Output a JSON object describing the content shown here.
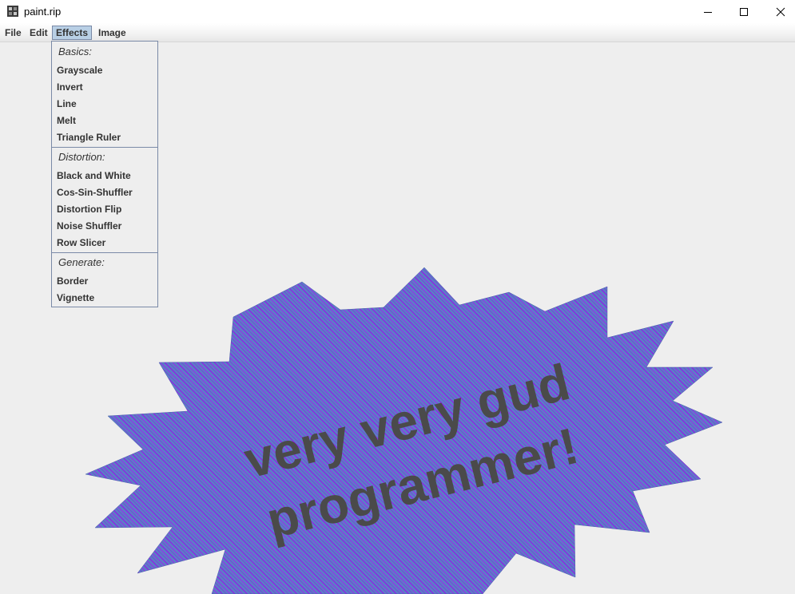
{
  "window": {
    "title": "paint.rip",
    "controls": [
      "minimize-icon",
      "maximize-icon",
      "close-icon"
    ]
  },
  "menubar": {
    "items": [
      {
        "label": "File"
      },
      {
        "label": "Edit"
      },
      {
        "label": "Effects",
        "active": true
      },
      {
        "label": "Image"
      }
    ]
  },
  "effects_menu": {
    "sections": [
      {
        "label": "Basics:",
        "items": [
          "Grayscale",
          "Invert",
          "Line",
          "Melt",
          "Triangle Ruler"
        ]
      },
      {
        "label": "Distortion:",
        "items": [
          "Black and White",
          "Cos-Sin-Shuffler",
          "Distortion Flip",
          "Noise Shuffler",
          "Row Slicer"
        ]
      },
      {
        "label": "Generate:",
        "items": [
          "Border",
          "Vignette"
        ]
      }
    ]
  },
  "canvas": {
    "text_line1": "very very gud",
    "text_line2": "programmer!",
    "colors": {
      "background": "#eeeeee",
      "starburst_fill": "#5b7fc6",
      "stripe": "#8a2be2",
      "text": "#4a4a4a",
      "highlight_text": "#111111"
    }
  }
}
